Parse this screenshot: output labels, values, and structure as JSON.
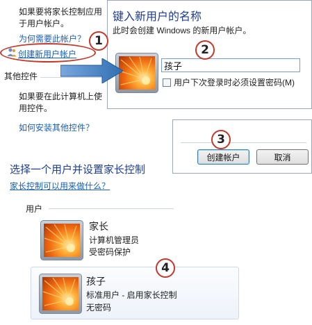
{
  "background_panel": {
    "para1": "如果要将家长控制应用于用户帐户。",
    "why_link": "为何需要此帐户？",
    "create_link": "创建新用户帐户",
    "other_controls": "其他控件",
    "para2": "如果要在此计算机上使用控件。",
    "install_link": "如何安装其他控件？"
  },
  "dialog": {
    "title": "键入新用户的名称",
    "description": "此时会创建 Windows 的新用户帐户。",
    "name_value": "孩子",
    "checkbox_label": "用户下次登录时必须设置密码(M)"
  },
  "buttons": {
    "create": "创建帐户",
    "cancel": "取消"
  },
  "section": {
    "header": "选择一个用户并设置家长控制",
    "link": "家长控制可以用来做什么？",
    "users_label": "用户"
  },
  "users": [
    {
      "name": "家长",
      "role": "计算机管理员",
      "password": "受密码保护"
    },
    {
      "name": "孩子",
      "role": "标准用户 - 启用家长控制",
      "password": "无密码"
    }
  ],
  "badges": [
    "1",
    "2",
    "3",
    "4"
  ],
  "colors": {
    "link": "#1a5fb4",
    "header": "#1e3d8f",
    "callout": "#c0392b",
    "arrow": "#2f6fb3"
  },
  "icons": {
    "avatar": "flower-avatar-icon",
    "users": "users-icon",
    "arrow": "arrow-right-icon"
  }
}
